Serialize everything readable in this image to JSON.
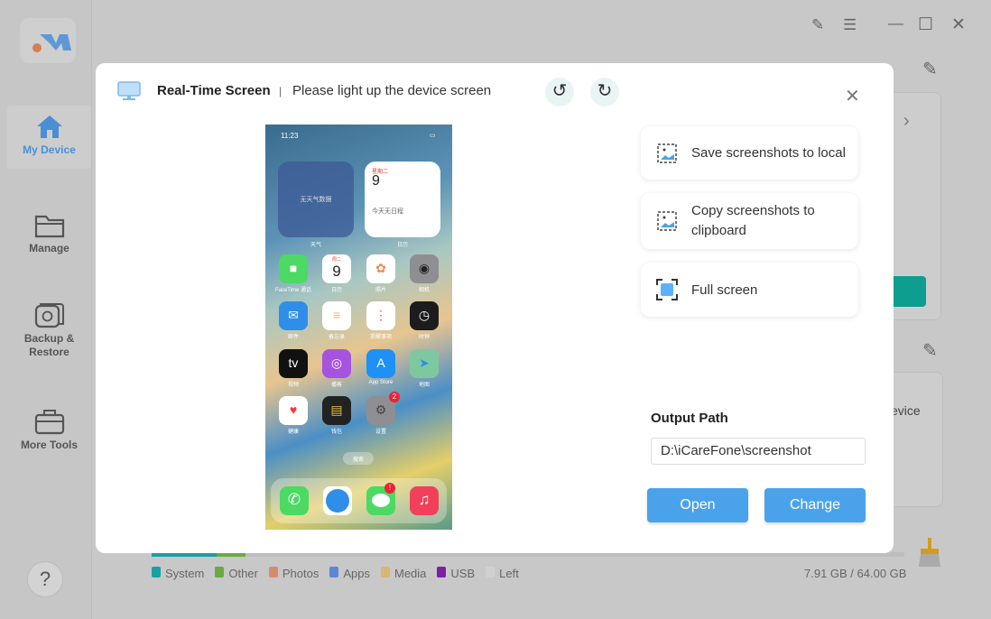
{
  "sidebar": {
    "items": [
      {
        "label": "My Device",
        "icon": "home-icon"
      },
      {
        "label": "Manage",
        "icon": "folder-icon"
      },
      {
        "label": "Backup & Restore",
        "icon": "backup-icon"
      },
      {
        "label": "More Tools",
        "icon": "toolbox-icon"
      }
    ],
    "help": "?"
  },
  "background": {
    "device_text": "evice",
    "storage_used": "7.91 GB / 64.00 GB",
    "legend": [
      "System",
      "Other",
      "Photos",
      "Apps",
      "Media",
      "USB",
      "Left"
    ],
    "legend_colors": [
      "#1a9fa3",
      "#6aaa46",
      "#d88a6c",
      "#5b88d3",
      "#d9b674",
      "#7d1fa0",
      "#d0d0d0"
    ]
  },
  "modal": {
    "title": "Real-Time Screen",
    "separator": "|",
    "hint": "Please light up the device screen",
    "options": [
      "Save screenshots to local",
      "Copy screenshots to clipboard",
      "Full screen"
    ],
    "output_label": "Output Path",
    "output_path": "D:\\iCareFone\\screenshot",
    "open": "Open",
    "change": "Change"
  },
  "phone": {
    "time": "11:23",
    "weather_widget": "无天气数据",
    "weather_label": "天气",
    "cal_day": "星期二",
    "cal_date": "9",
    "cal_text": "今天无日程",
    "cal_label": "日历",
    "apps": [
      "FaceTime 通话",
      "日历",
      "照片",
      "相机",
      "邮件",
      "备忘录",
      "提醒事项",
      "时钟",
      "视频",
      "播客",
      "App Store",
      "地图",
      "健康",
      "钱包",
      "设置"
    ],
    "settings_badge": "2",
    "messages_badge": "!",
    "search": "搜索",
    "cal_icon_day": "周二",
    "cal_icon_date": "9",
    "tv": "tv"
  }
}
